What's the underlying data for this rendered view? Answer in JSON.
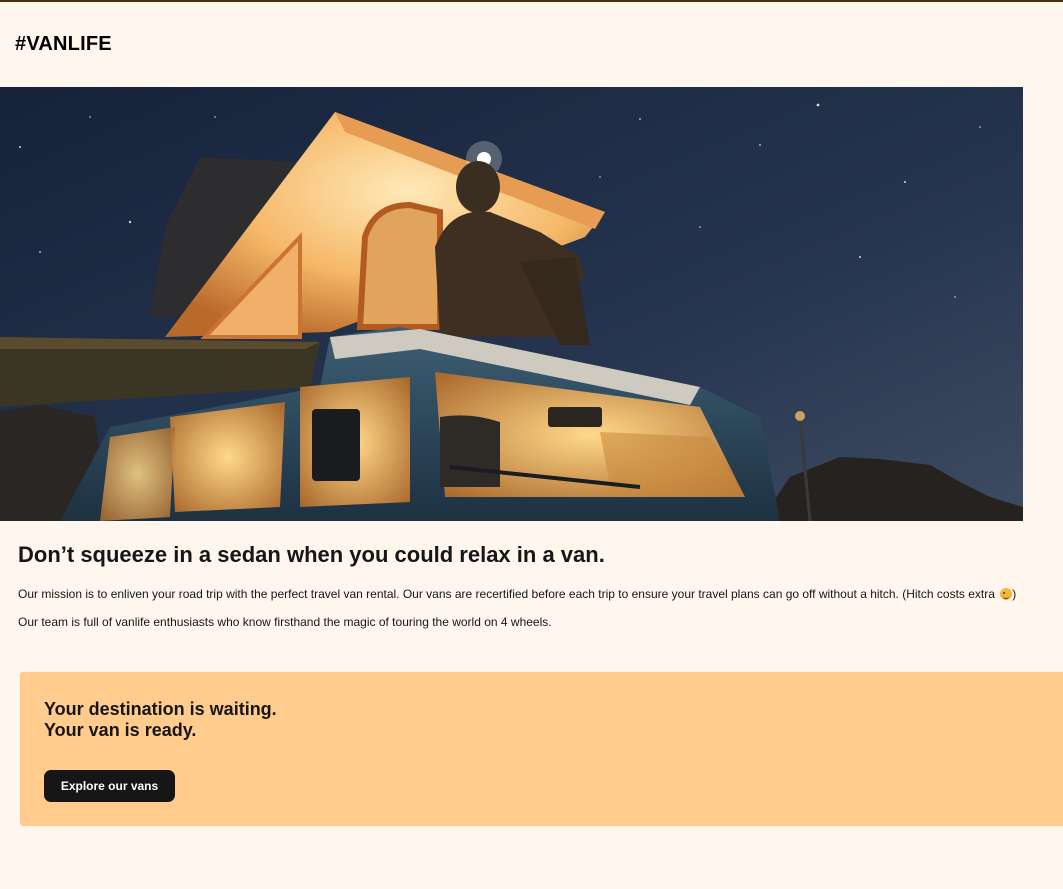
{
  "header": {
    "logo": "#VANLIFE"
  },
  "hero": {
    "alt": "Person sitting on top of a lit-up camper van under a starry night sky"
  },
  "main": {
    "title": "Don’t squeeze in a sedan when you could relax in a van.",
    "mission_text": "Our mission is to enliven your road trip with the perfect travel van rental. Our vans are recertified before each trip to ensure your travel plans can go off without a hitch. (Hitch costs extra ",
    "mission_close": ")",
    "team_text": "Our team is full of vanlife enthusiasts who know firsthand the magic of touring the world on 4 wheels."
  },
  "cta": {
    "line1": "Your destination is waiting.",
    "line2": "Your van is ready.",
    "button_label": "Explore our vans"
  },
  "colors": {
    "page_background": "#FFF7ED",
    "banner_background": "#FFCC8D",
    "button_background": "#161616",
    "button_text": "#FFFFFF",
    "text": "#161616"
  }
}
